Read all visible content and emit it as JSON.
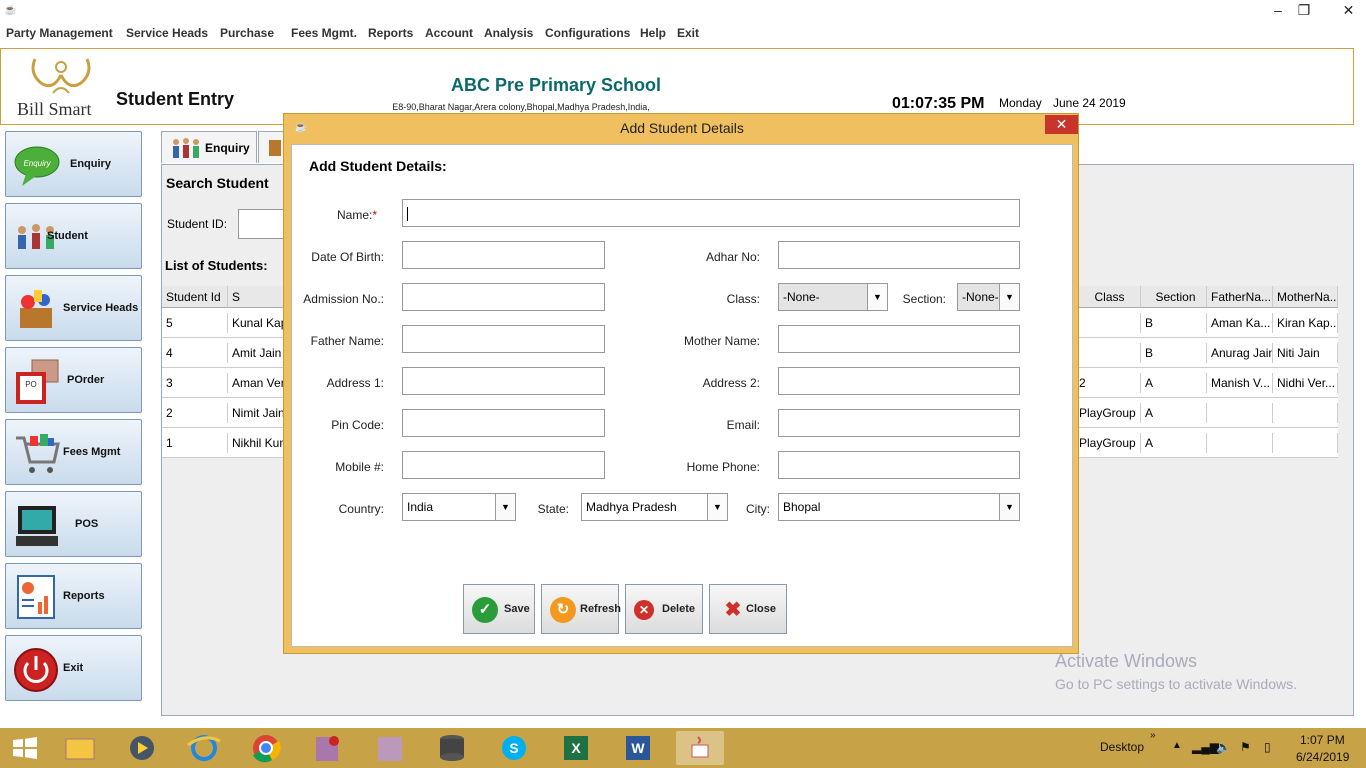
{
  "menu": [
    "Party Management",
    "Service Heads",
    "Purchase",
    "Fees Mgmt.",
    "Reports",
    "Account",
    "Analysis",
    "Configurations",
    "Help",
    "Exit"
  ],
  "header": {
    "logo_text": "Bill Smart",
    "page_title": "Student Entry",
    "school_name": "ABC Pre Primary School",
    "school_address": "E8-90,Bharat Nagar,Arera colony,Bhopal,Madhya Pradesh,India,",
    "time": "01:07:35 PM",
    "day": "Monday",
    "date": "June 24 2019"
  },
  "sidebar": [
    {
      "label": "Enquiry",
      "icon": "enquiry-bubble-icon"
    },
    {
      "label": "Student",
      "icon": "students-group-icon"
    },
    {
      "label": "Service Heads",
      "icon": "toys-box-icon"
    },
    {
      "label": "POrder",
      "icon": "purchase-order-icon"
    },
    {
      "label": "Fees Mgmt",
      "icon": "shopping-cart-icon"
    },
    {
      "label": "POS",
      "icon": "pos-terminal-icon"
    },
    {
      "label": "Reports",
      "icon": "report-chart-icon"
    },
    {
      "label": "Exit",
      "icon": "power-icon"
    }
  ],
  "tabs": {
    "enquiry": "Enquiry"
  },
  "search": {
    "title": "Search Student",
    "student_id_label": "Student ID:"
  },
  "list": {
    "title": "List of Students:",
    "columns_left": [
      "Student Id",
      "S"
    ],
    "columns_right": [
      "Class",
      "Section",
      "FatherNa...",
      "MotherNa..."
    ],
    "rows": [
      {
        "id": "5",
        "name": "Kunal Kap",
        "cls": "",
        "section": "B",
        "father": "Aman Ka...",
        "mother": "Kiran Kap..."
      },
      {
        "id": "4",
        "name": "Amit Jain",
        "cls": "",
        "section": "B",
        "father": "Anurag Jain",
        "mother": "Niti Jain"
      },
      {
        "id": "3",
        "name": "Aman Ver",
        "cls": "2",
        "section": "A",
        "father": "Manish V...",
        "mother": "Nidhi Ver..."
      },
      {
        "id": "2",
        "name": "Nimit Jain",
        "cls": "PlayGroup",
        "section": "A",
        "father": "",
        "mother": ""
      },
      {
        "id": "1",
        "name": "Nikhil Kum",
        "cls": "PlayGroup",
        "section": "A",
        "father": "",
        "mother": ""
      }
    ]
  },
  "watermark": {
    "line1": "Activate Windows",
    "line2": "Go to PC settings to activate Windows."
  },
  "dialog": {
    "title": "Add Student Details",
    "heading": "Add Student Details:",
    "labels": {
      "name": "Name:",
      "required": "*",
      "dob": "Date Of Birth:",
      "adhar": "Adhar No:",
      "admission": "Admission No.:",
      "class": "Class:",
      "section": "Section:",
      "father": "Father Name:",
      "mother": "Mother Name:",
      "address1": "Address 1:",
      "address2": "Address 2:",
      "pin": "Pin Code:",
      "email": "Email:",
      "mobile": "Mobile #:",
      "home_phone": "Home Phone:",
      "country": "Country:",
      "state": "State:",
      "city": "City:"
    },
    "values": {
      "class": "-None-",
      "section": "-None-",
      "country": "India",
      "state": "Madhya Pradesh",
      "city": "Bhopal"
    },
    "buttons": {
      "save": "Save",
      "refresh": "Refresh",
      "delete": "Delete",
      "close": "Close"
    }
  },
  "tray": {
    "desktop": "Desktop",
    "time": "1:07 PM",
    "date": "6/24/2019"
  }
}
